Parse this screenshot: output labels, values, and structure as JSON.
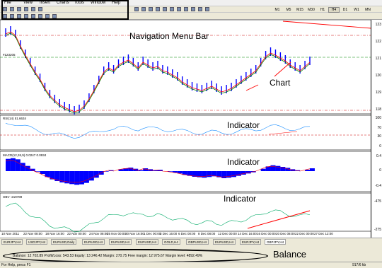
{
  "menu": {
    "items": [
      "File",
      "View",
      "Insert",
      "Charts",
      "Tools",
      "Window",
      "Help"
    ]
  },
  "timeframes": [
    "M1",
    "M5",
    "M15",
    "M30",
    "H1",
    "H4",
    "D1",
    "W1",
    "MN"
  ],
  "active_timeframe": "H4",
  "annotations": {
    "navigation": "Navigation Menu Bar",
    "chart": "Chart",
    "indicator1": "Indicator",
    "indicator2": "Indicator",
    "indicator3": "Indicator",
    "balance": "Balance"
  },
  "price_axis": [
    "123",
    "122",
    "121",
    "120",
    "119",
    "118"
  ],
  "price_label": "#123205",
  "rsi_label": "RSI(14) 51.6634",
  "macd_label": "MACD(12,26,9) 0.0247 0.0934",
  "obv_label": "OBV -219789",
  "rsi_axis": [
    "100",
    "70",
    "30",
    "0"
  ],
  "macd_axis": [
    "0.4",
    "0",
    "-0.4"
  ],
  "obv_axis": [
    "-475",
    "-275"
  ],
  "time_axis": [
    "10 Nov 2011",
    "22 Nov 08:00",
    "18 Nov 16:00",
    "22 Nov 00:00",
    "24 Nov 08:00",
    "25 Nov 00:00",
    "30 Nov 16:00",
    "1 Dec 00:00",
    "3 Dec 16:00",
    "6 Dec 00:00",
    "8 Dec 08:00",
    "12 Dec 00:00",
    "14 Dec 16:00",
    "16 Dec 00:00",
    "20 Dec 08:00",
    "22 Dec 00:00",
    "27 Dec 12:00"
  ],
  "tabs": [
    "EURJPY,H4",
    "USDJPY,H4",
    "EURUSD,Daily",
    "EURUSD,H4",
    "EURUSD,H4",
    "EURUSD,H4",
    "GOLD,H4",
    "GBPUSD,H4",
    "EURUSD,H4",
    "EURJPY,H4",
    "GBPJPY,H4"
  ],
  "active_tab_index": 10,
  "balance": {
    "text": "Balance: 12 702.89  Profit/Loss: 543.53  Equity: 13 246.42  Margin: 270.75  Free margin: 12 975.67  Margin level: 4892.49%"
  },
  "status": {
    "help": "For Help, press F1",
    "traffic": "917/6 kb"
  },
  "colors": {
    "candle": "#0000ff",
    "ma_fast": "#ff0000",
    "ma_slow": "#008000",
    "rsi": "#1e90ff",
    "macd_hist": "#0000ff",
    "obv": "#00aa66",
    "trend": "#ff0000"
  }
}
